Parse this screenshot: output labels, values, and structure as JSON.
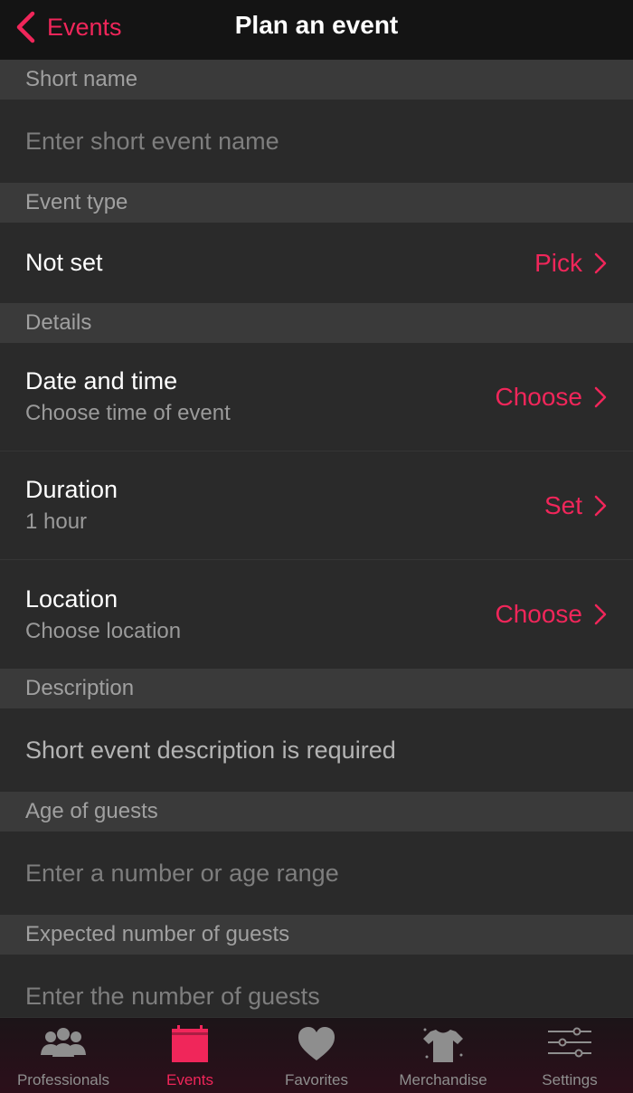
{
  "nav": {
    "back_label": "Events",
    "title": "Plan an event"
  },
  "sections": {
    "short_name": {
      "header": "Short name",
      "placeholder": "Enter short event name"
    },
    "event_type": {
      "header": "Event type",
      "value": "Not set",
      "action": "Pick"
    },
    "details": {
      "header": "Details",
      "date": {
        "title": "Date and time",
        "subtitle": "Choose time of event",
        "action": "Choose"
      },
      "duration": {
        "title": "Duration",
        "subtitle": "1 hour",
        "action": "Set"
      },
      "location": {
        "title": "Location",
        "subtitle": "Choose location",
        "action": "Choose"
      }
    },
    "description": {
      "header": "Description",
      "text": "Short event description is required"
    },
    "age": {
      "header": "Age of guests",
      "placeholder": "Enter a number or age range"
    },
    "guests": {
      "header": "Expected number of guests",
      "placeholder": "Enter the number of guests"
    }
  },
  "tabs": [
    {
      "label": "Professionals",
      "icon": "people-icon"
    },
    {
      "label": "Events",
      "icon": "calendar-icon",
      "active": true
    },
    {
      "label": "Favorites",
      "icon": "heart-icon"
    },
    {
      "label": "Merchandise",
      "icon": "tshirt-icon"
    },
    {
      "label": "Settings",
      "icon": "sliders-icon"
    }
  ],
  "colors": {
    "accent": "#f0265a",
    "background": "#2a2a2a",
    "section": "#3a3a3a",
    "nav": "#141414"
  }
}
